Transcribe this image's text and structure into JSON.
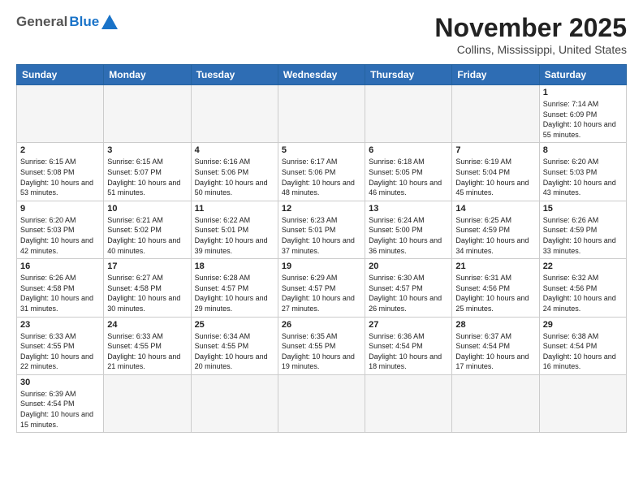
{
  "header": {
    "logo_general": "General",
    "logo_blue": "Blue",
    "title": "November 2025",
    "subtitle": "Collins, Mississippi, United States"
  },
  "days_of_week": [
    "Sunday",
    "Monday",
    "Tuesday",
    "Wednesday",
    "Thursday",
    "Friday",
    "Saturday"
  ],
  "weeks": [
    [
      {
        "day": "",
        "info": ""
      },
      {
        "day": "",
        "info": ""
      },
      {
        "day": "",
        "info": ""
      },
      {
        "day": "",
        "info": ""
      },
      {
        "day": "",
        "info": ""
      },
      {
        "day": "",
        "info": ""
      },
      {
        "day": "1",
        "info": "Sunrise: 7:14 AM\nSunset: 6:09 PM\nDaylight: 10 hours and 55 minutes."
      }
    ],
    [
      {
        "day": "2",
        "info": "Sunrise: 6:15 AM\nSunset: 5:08 PM\nDaylight: 10 hours and 53 minutes."
      },
      {
        "day": "3",
        "info": "Sunrise: 6:15 AM\nSunset: 5:07 PM\nDaylight: 10 hours and 51 minutes."
      },
      {
        "day": "4",
        "info": "Sunrise: 6:16 AM\nSunset: 5:06 PM\nDaylight: 10 hours and 50 minutes."
      },
      {
        "day": "5",
        "info": "Sunrise: 6:17 AM\nSunset: 5:06 PM\nDaylight: 10 hours and 48 minutes."
      },
      {
        "day": "6",
        "info": "Sunrise: 6:18 AM\nSunset: 5:05 PM\nDaylight: 10 hours and 46 minutes."
      },
      {
        "day": "7",
        "info": "Sunrise: 6:19 AM\nSunset: 5:04 PM\nDaylight: 10 hours and 45 minutes."
      },
      {
        "day": "8",
        "info": "Sunrise: 6:20 AM\nSunset: 5:03 PM\nDaylight: 10 hours and 43 minutes."
      }
    ],
    [
      {
        "day": "9",
        "info": "Sunrise: 6:20 AM\nSunset: 5:03 PM\nDaylight: 10 hours and 42 minutes."
      },
      {
        "day": "10",
        "info": "Sunrise: 6:21 AM\nSunset: 5:02 PM\nDaylight: 10 hours and 40 minutes."
      },
      {
        "day": "11",
        "info": "Sunrise: 6:22 AM\nSunset: 5:01 PM\nDaylight: 10 hours and 39 minutes."
      },
      {
        "day": "12",
        "info": "Sunrise: 6:23 AM\nSunset: 5:01 PM\nDaylight: 10 hours and 37 minutes."
      },
      {
        "day": "13",
        "info": "Sunrise: 6:24 AM\nSunset: 5:00 PM\nDaylight: 10 hours and 36 minutes."
      },
      {
        "day": "14",
        "info": "Sunrise: 6:25 AM\nSunset: 4:59 PM\nDaylight: 10 hours and 34 minutes."
      },
      {
        "day": "15",
        "info": "Sunrise: 6:26 AM\nSunset: 4:59 PM\nDaylight: 10 hours and 33 minutes."
      }
    ],
    [
      {
        "day": "16",
        "info": "Sunrise: 6:26 AM\nSunset: 4:58 PM\nDaylight: 10 hours and 31 minutes."
      },
      {
        "day": "17",
        "info": "Sunrise: 6:27 AM\nSunset: 4:58 PM\nDaylight: 10 hours and 30 minutes."
      },
      {
        "day": "18",
        "info": "Sunrise: 6:28 AM\nSunset: 4:57 PM\nDaylight: 10 hours and 29 minutes."
      },
      {
        "day": "19",
        "info": "Sunrise: 6:29 AM\nSunset: 4:57 PM\nDaylight: 10 hours and 27 minutes."
      },
      {
        "day": "20",
        "info": "Sunrise: 6:30 AM\nSunset: 4:57 PM\nDaylight: 10 hours and 26 minutes."
      },
      {
        "day": "21",
        "info": "Sunrise: 6:31 AM\nSunset: 4:56 PM\nDaylight: 10 hours and 25 minutes."
      },
      {
        "day": "22",
        "info": "Sunrise: 6:32 AM\nSunset: 4:56 PM\nDaylight: 10 hours and 24 minutes."
      }
    ],
    [
      {
        "day": "23",
        "info": "Sunrise: 6:33 AM\nSunset: 4:55 PM\nDaylight: 10 hours and 22 minutes."
      },
      {
        "day": "24",
        "info": "Sunrise: 6:33 AM\nSunset: 4:55 PM\nDaylight: 10 hours and 21 minutes."
      },
      {
        "day": "25",
        "info": "Sunrise: 6:34 AM\nSunset: 4:55 PM\nDaylight: 10 hours and 20 minutes."
      },
      {
        "day": "26",
        "info": "Sunrise: 6:35 AM\nSunset: 4:55 PM\nDaylight: 10 hours and 19 minutes."
      },
      {
        "day": "27",
        "info": "Sunrise: 6:36 AM\nSunset: 4:54 PM\nDaylight: 10 hours and 18 minutes."
      },
      {
        "day": "28",
        "info": "Sunrise: 6:37 AM\nSunset: 4:54 PM\nDaylight: 10 hours and 17 minutes."
      },
      {
        "day": "29",
        "info": "Sunrise: 6:38 AM\nSunset: 4:54 PM\nDaylight: 10 hours and 16 minutes."
      }
    ],
    [
      {
        "day": "30",
        "info": "Sunrise: 6:39 AM\nSunset: 4:54 PM\nDaylight: 10 hours and 15 minutes."
      },
      {
        "day": "",
        "info": ""
      },
      {
        "day": "",
        "info": ""
      },
      {
        "day": "",
        "info": ""
      },
      {
        "day": "",
        "info": ""
      },
      {
        "day": "",
        "info": ""
      },
      {
        "day": "",
        "info": ""
      }
    ]
  ]
}
